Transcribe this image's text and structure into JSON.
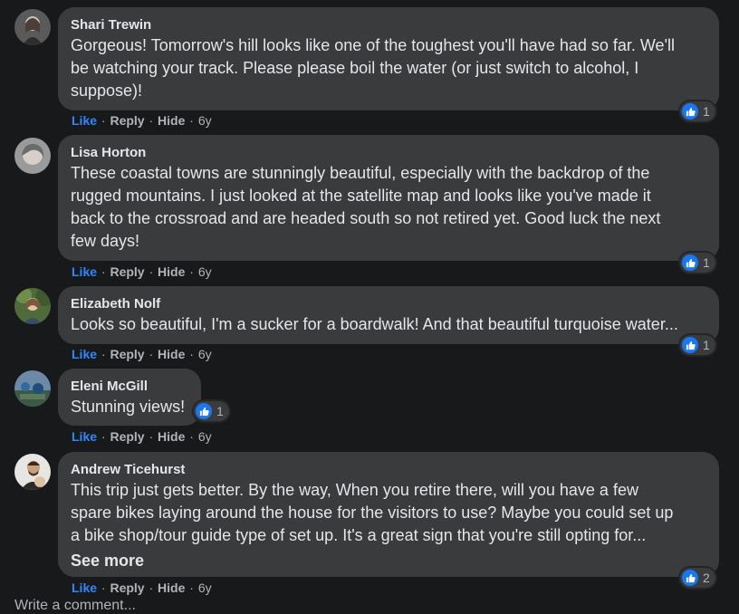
{
  "actions": {
    "like": "Like",
    "reply": "Reply",
    "hide": "Hide",
    "sep": "·"
  },
  "colors": {
    "background": "#18191a",
    "bubble": "#3a3b3c",
    "link_blue": "#2d88ff",
    "reaction_blue": "#1877f2",
    "muted": "#b0b3b8"
  },
  "comments": [
    {
      "author": "Shari Trewin",
      "lines": [
        "Gorgeous! Tomorrow's hill looks like one of the toughest you'll have had so far. We'll",
        "be watching your track. Please please boil the water (or just switch to alcohol, I",
        "suppose)!"
      ],
      "age": "6y",
      "reaction_icon": "thumbs-up-icon",
      "reactions": "1"
    },
    {
      "author": "Lisa Horton",
      "lines": [
        "These coastal towns are stunningly beautiful, especially with the backdrop of the",
        "rugged mountains. I just looked at the satellite map and looks like you've made it",
        "back to the crossroad and are headed south so not retired yet. Good luck the next",
        "few days!"
      ],
      "age": "6y",
      "reaction_icon": "thumbs-up-icon",
      "reactions": "1"
    },
    {
      "author": "Elizabeth Nolf",
      "lines": [
        "Looks so beautiful, I'm a sucker for a boardwalk! And that beautiful turquoise water..."
      ],
      "age": "6y",
      "reaction_icon": "thumbs-up-icon",
      "reactions": "1"
    },
    {
      "author": "Eleni McGill",
      "lines": [
        "Stunning views!"
      ],
      "age": "6y",
      "reaction_icon": "thumbs-up-icon",
      "reactions": "1"
    },
    {
      "author": "Andrew Ticehurst",
      "lines": [
        "This trip just gets better. By the way, When you retire there, will you have a few",
        "spare bikes laying around the house for the visitors to use? Maybe you could set up",
        "a bike shop/tour guide type of set up. It's a great sign that you're still opting for..."
      ],
      "see_more": "See more",
      "age": "6y",
      "reaction_icon": "thumbs-up-icon",
      "reactions": "2"
    }
  ],
  "write_comment": "Write a comment..."
}
